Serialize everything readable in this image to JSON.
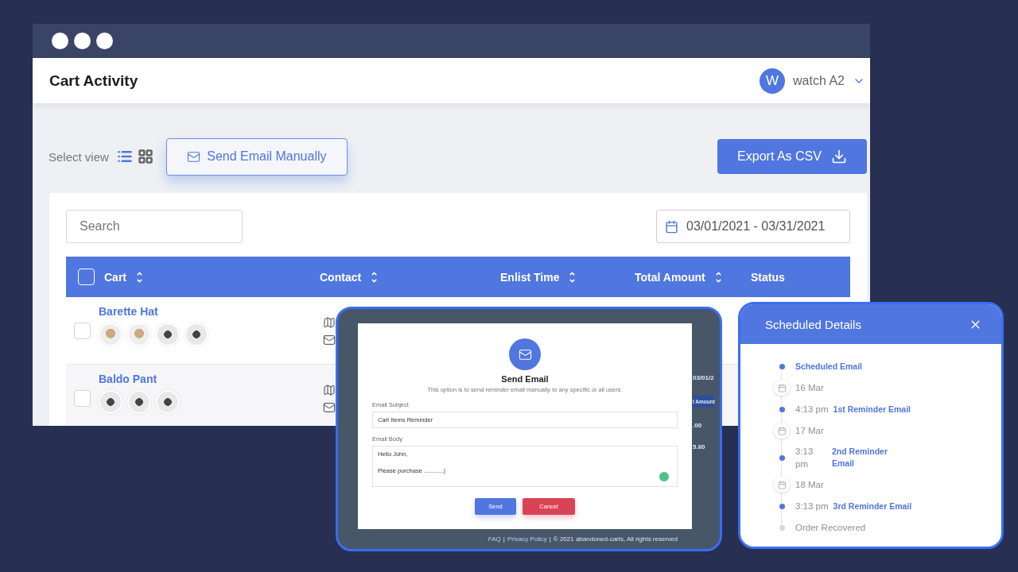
{
  "window": {
    "title": "Cart Activity",
    "user": {
      "initial": "W",
      "name": "watch A2"
    }
  },
  "toolbar": {
    "select_view_label": "Select view",
    "views": [
      {
        "kind": "list",
        "selected": true
      },
      {
        "kind": "grid",
        "selected": false
      }
    ],
    "send_button": "Send Email Manually",
    "export_button": "Export As CSV"
  },
  "filters": {
    "search": {
      "placeholder": "Search"
    },
    "date_range": "03/01/2021 - 03/31/2021"
  },
  "table": {
    "select_all_checked": false,
    "columns": [
      {
        "label": "Cart",
        "sortable": true
      },
      {
        "label": "Contact",
        "sortable": true
      },
      {
        "label": "Enlist Time",
        "sortable": true
      },
      {
        "label": "Total Amount",
        "sortable": true
      },
      {
        "label": "Status",
        "sortable": false
      }
    ],
    "rows": [
      {
        "name": "Barette Hat",
        "checked": false,
        "thumbnails": [
          {
            "kind": "light"
          },
          {
            "kind": "light"
          },
          {
            "kind": "dark"
          },
          {
            "kind": "dark"
          }
        ]
      },
      {
        "name": "Baldo Pant",
        "checked": false,
        "thumbnails": [
          {
            "kind": "dark"
          },
          {
            "kind": "dark"
          },
          {
            "kind": "dark"
          }
        ]
      }
    ]
  },
  "email_dialog": {
    "backdrop_fragments": [
      "03/01/2",
      "l Amount",
      ".00",
      "5.60"
    ],
    "footer": [
      {
        "kind": "link",
        "text": "FAQ"
      },
      {
        "kind": "separator",
        "text": "|"
      },
      {
        "kind": "link",
        "text": "Privacy Policy"
      },
      {
        "kind": "separator",
        "text": "|"
      },
      {
        "kind": "text",
        "text": "© 2021 abandoned-carts, All rights reserved"
      }
    ],
    "title": "Send Email",
    "subtitle": "This option is to send reminder email manually to any specific or all users.",
    "subject_label": "Email Subject",
    "subject_value": "Cart Items Reminder",
    "body_label": "Email Body",
    "body_lines": [
      "Hello John,",
      "Please purchase ............|"
    ],
    "send_button": "Send",
    "cancel_button": "Cancel"
  },
  "scheduled_details": {
    "title": "Scheduled Details",
    "timeline": [
      {
        "kind": "event",
        "label": "Scheduled Email",
        "done": true
      },
      {
        "kind": "date",
        "label": "16 Mar"
      },
      {
        "kind": "event",
        "time": "4:13 pm",
        "label": "1st Reminder Email",
        "done": true
      },
      {
        "kind": "date",
        "label": "17 Mar"
      },
      {
        "kind": "event",
        "time": "3:13 pm",
        "label": "2nd Reminder Email",
        "done": true,
        "wrapped": true
      },
      {
        "kind": "date",
        "label": "18 Mar"
      },
      {
        "kind": "event",
        "time": "3:13 pm",
        "label": "3rd Reminder Email",
        "done": true
      },
      {
        "kind": "event",
        "label": "Order Recovered",
        "done": false
      }
    ]
  }
}
